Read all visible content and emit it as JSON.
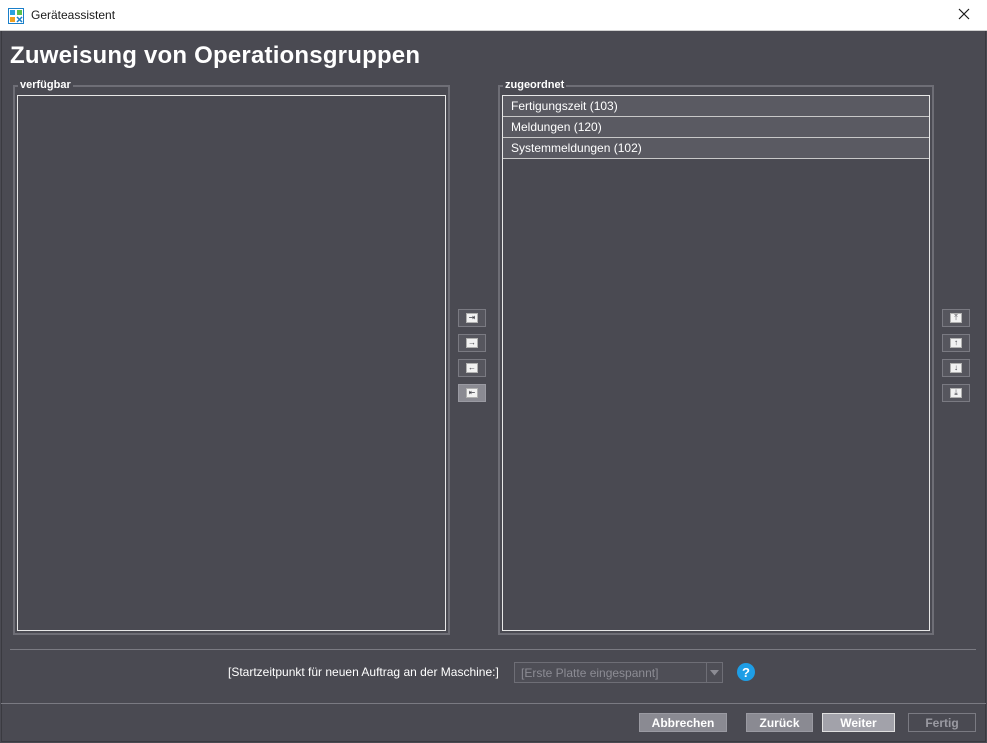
{
  "window": {
    "title": "Geräteassistent",
    "close_icon": "close-icon"
  },
  "page": {
    "title": "Zuweisung von Operationsgruppen"
  },
  "available": {
    "label": "verfügbar",
    "items": []
  },
  "assigned": {
    "label": "zugeordnet",
    "items": [
      {
        "label": "Fertigungszeit (103)"
      },
      {
        "label": "Meldungen (120)"
      },
      {
        "label": "Systemmeldungen (102)"
      }
    ]
  },
  "transfer_buttons": [
    {
      "name": "move-all-right-button",
      "icon": "double-arrow-right-icon",
      "glyph": "⇥"
    },
    {
      "name": "move-right-button",
      "icon": "arrow-right-icon",
      "glyph": "→"
    },
    {
      "name": "move-left-button",
      "icon": "arrow-left-icon",
      "glyph": "←"
    },
    {
      "name": "move-all-left-button",
      "icon": "double-arrow-left-icon",
      "glyph": "⇤"
    }
  ],
  "order_buttons": [
    {
      "name": "move-top-button",
      "icon": "move-top-icon",
      "glyph": "⤒"
    },
    {
      "name": "move-up-button",
      "icon": "arrow-up-icon",
      "glyph": "↑"
    },
    {
      "name": "move-down-button",
      "icon": "arrow-down-icon",
      "glyph": "↓"
    },
    {
      "name": "move-bottom-button",
      "icon": "move-bottom-icon",
      "glyph": "⤓"
    }
  ],
  "start_time": {
    "label": "[Startzeitpunkt für neuen Auftrag an der Maschine:]",
    "value": "[Erste Platte eingespannt]"
  },
  "footer": {
    "cancel": "Abbrechen",
    "back": "Zurück",
    "next": "Weiter",
    "finish": "Fertig"
  },
  "colors": {
    "background": "#4a4a52",
    "help_accent": "#1e9ee6"
  }
}
